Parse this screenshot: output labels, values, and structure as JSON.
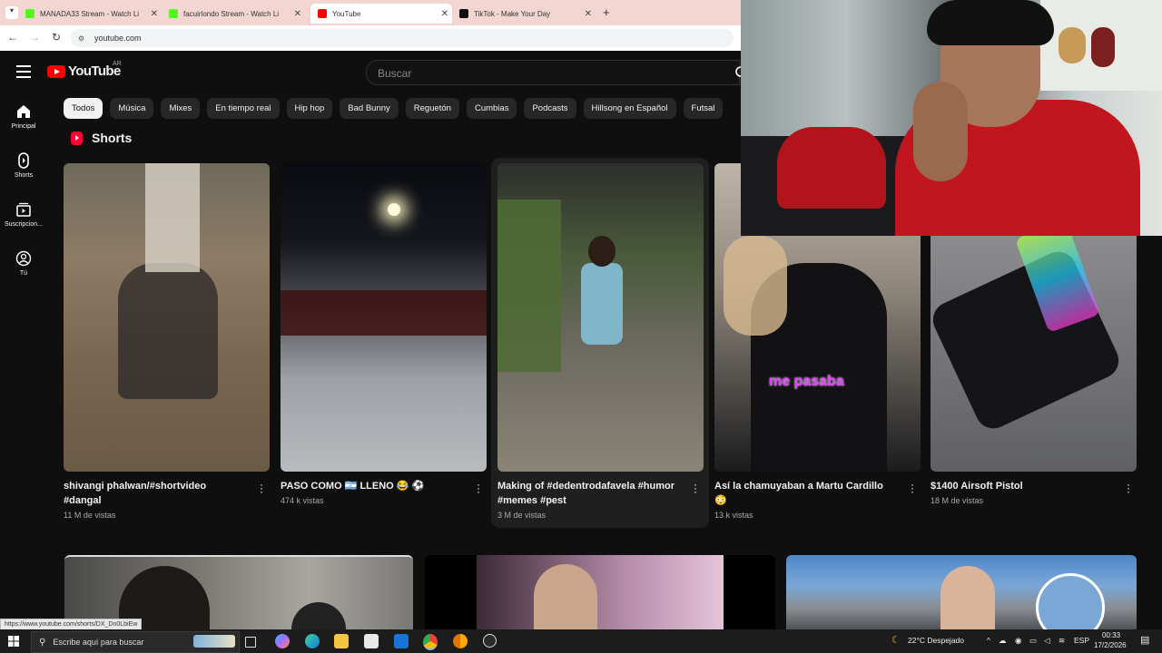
{
  "browser": {
    "tabs": [
      {
        "label": "MANADA33 Stream - Watch Li",
        "favicon_color": "#53fc18"
      },
      {
        "label": "facuirlondo Stream - Watch Li",
        "favicon_color": "#53fc18"
      },
      {
        "label": "YouTube",
        "favicon_color": "#ff0000"
      },
      {
        "label": "TikTok - Make Your Day",
        "favicon_color": "#111111"
      }
    ],
    "new_tab": "+",
    "address": "youtube.com"
  },
  "youtube": {
    "logo_text": "YouTube",
    "country_code": "AR",
    "search_placeholder": "Buscar",
    "nav": [
      {
        "label": "Principal",
        "icon": "home-icon"
      },
      {
        "label": "Shorts",
        "icon": "shorts-icon"
      },
      {
        "label": "Suscripcion...",
        "icon": "subscriptions-icon"
      },
      {
        "label": "Tú",
        "icon": "you-icon"
      }
    ],
    "chips": [
      "Todos",
      "Música",
      "Mixes",
      "En tiempo real",
      "Hip hop",
      "Bad Bunny",
      "Reguetón",
      "Cumbias",
      "Podcasts",
      "Hillsong en Español",
      "Futsal"
    ],
    "shorts_heading": "Shorts",
    "shorts": [
      {
        "title": "shivangi phalwan/#shortvideo #dangal",
        "views": "11 M de vistas"
      },
      {
        "title": "PASO COMO 🇦🇷 LLENO 😂 ⚽",
        "views": "474 k vistas"
      },
      {
        "title": "Making of #dedentrodafavela #humor #memes #pest",
        "views": "3 M de vistas"
      },
      {
        "title": "Así la chamuyaban a Martu Cardillo 😳",
        "views": "13 k vistas",
        "overlay": "me pasaba"
      },
      {
        "title": "$1400 Airsoft Pistol",
        "views": "18 M de vistas"
      }
    ]
  },
  "status_url": "https://www.youtube.com/shorts/DX_Dn0LbiEw",
  "taskbar": {
    "search_placeholder": "Escribe aquí para buscar",
    "weather": "22°C  Despejado",
    "language": "ESP",
    "time": "00:33",
    "date": "17/2/2026"
  }
}
